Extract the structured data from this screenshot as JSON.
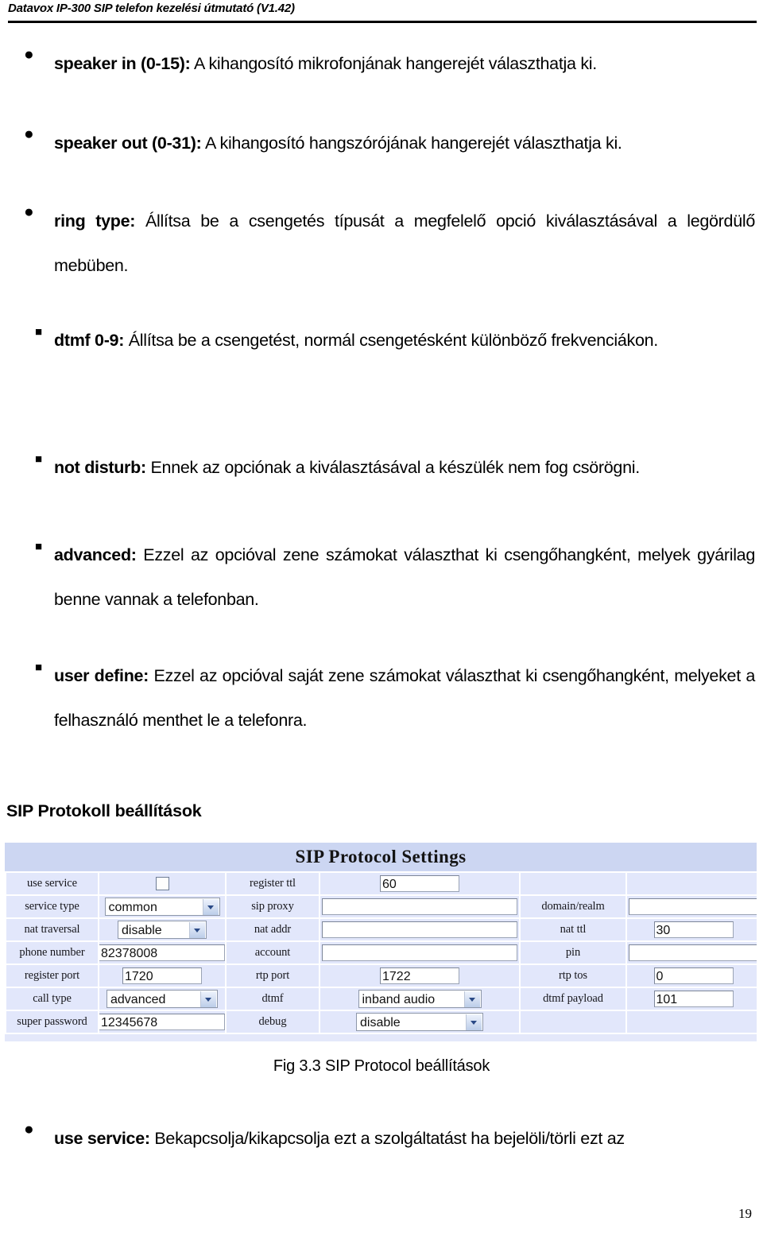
{
  "header": {
    "running_title": "Datavox IP-300 SIP telefon kezelési útmutató (V1.42)"
  },
  "bullets": [
    {
      "marker": "disc",
      "keyword": "speaker in (0-15):",
      "text": " A kihangosító mikrofonjának hangerejét választhatja ki."
    },
    {
      "marker": "disc",
      "keyword": "speaker out (0-31):",
      "text": " A kihangosító hangszórójának hangerejét választhatja ki."
    },
    {
      "marker": "disc",
      "keyword": "ring type:",
      "text": " Állítsa be a csengetés típusát a megfelelő opció kiválasztásával a legördülő mebüben."
    },
    {
      "marker": "square",
      "keyword": "dtmf 0-9:",
      "text": " Állítsa be a csengetést, normál csengetésként különböző frekvenciákon."
    },
    {
      "marker": "square",
      "keyword": "not disturb:",
      "text": " Ennek az opciónak a kiválasztásával a készülék nem fog csörögni."
    },
    {
      "marker": "square",
      "keyword": "advanced:",
      "text": " Ezzel az opcióval zene számokat választhat ki csengőhangként, melyek gyárilag benne vannak a telefonban."
    },
    {
      "marker": "square",
      "keyword": "user define:",
      "text": " Ezzel az opcióval saját zene számokat választhat ki csengőhangként, melyeket a felhasználó menthet le a telefonra."
    }
  ],
  "section_heading": "SIP Protokoll beállítások",
  "sip_form": {
    "title": "SIP Protocol Settings",
    "rows": [
      {
        "c1_label": "use service",
        "c1_type": "checkbox",
        "c1_value": "",
        "c2_label": "register ttl",
        "c2_type": "text-med",
        "c2_value": "60",
        "c3_label": "",
        "c3_type": "empty",
        "c3_value": ""
      },
      {
        "c1_label": "service type",
        "c1_type": "select-wide",
        "c1_value": "common",
        "c2_label": "sip proxy",
        "c2_type": "text-full",
        "c2_value": "",
        "c3_label": "domain/realm",
        "c3_type": "text-full",
        "c3_value": ""
      },
      {
        "c1_label": "nat traversal",
        "c1_type": "select-narrow",
        "c1_value": "disable",
        "c2_label": "nat addr",
        "c2_type": "text-full",
        "c2_value": "",
        "c3_label": "nat ttl",
        "c3_type": "text-med",
        "c3_value": "30"
      },
      {
        "c1_label": "phone number",
        "c1_type": "text-full",
        "c1_value": "82378008",
        "c2_label": "account",
        "c2_type": "text-full",
        "c2_value": "",
        "c3_label": "pin",
        "c3_type": "text-full",
        "c3_value": ""
      },
      {
        "c1_label": "register port",
        "c1_type": "text-med",
        "c1_value": "1720",
        "c2_label": "rtp port",
        "c2_type": "text-med",
        "c2_value": "1722",
        "c3_label": "rtp tos",
        "c3_type": "text-med",
        "c3_value": "0"
      },
      {
        "c1_label": "call type",
        "c1_type": "select-wide",
        "c1_value": "advanced",
        "c2_label": "dtmf",
        "c2_type": "select-wide",
        "c2_value": "inband audio",
        "c3_label": "dtmf payload",
        "c3_type": "text-med",
        "c3_value": "101"
      },
      {
        "c1_label": "super password",
        "c1_type": "text-full",
        "c1_value": "12345678",
        "c2_label": "debug",
        "c2_type": "select-wide",
        "c2_value": "disable",
        "c3_label": "",
        "c3_type": "empty",
        "c3_value": ""
      }
    ]
  },
  "figure_caption": "Fig 3.3 SIP Protocol beállítások",
  "trailing_bullet": {
    "marker": "disc",
    "keyword": "use service:",
    "text": " Bekapcsolja/kikapcsolja ezt a szolgáltatást ha bejelöli/törli ezt az"
  },
  "page_number": "19"
}
